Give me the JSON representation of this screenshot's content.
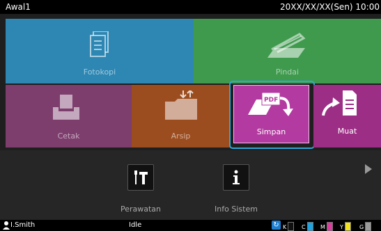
{
  "header": {
    "title": "Awal1",
    "clock": "20XX/XX/XX(Sen) 10:00"
  },
  "tiles": {
    "fotokopi": "Fotokopi",
    "pindai": "Pindai",
    "cetak": "Cetak",
    "arsip": "Arsip",
    "simpan": "Simpan",
    "muat": "Muat",
    "simpan_icon_text": "PDF"
  },
  "tools": {
    "perawatan": "Perawatan",
    "info_sistem": "Info Sistem"
  },
  "status": {
    "user": "I.Smith",
    "state": "Idle",
    "inks": [
      {
        "label": "K",
        "color": "#111111"
      },
      {
        "label": "C",
        "color": "#1fa3e0"
      },
      {
        "label": "M",
        "color": "#d93e9c"
      },
      {
        "label": "Y",
        "color": "#f2e11c"
      },
      {
        "label": "G",
        "color": "#9a9a9a"
      }
    ]
  },
  "colors": {
    "fotokopi": "#2e87b3",
    "pindai": "#3f9a4e",
    "cetak": "#7d3e6d",
    "arsip": "#9c4d1f",
    "simpan": "#b33aa0",
    "muat": "#9c2f85",
    "selection": "#2fa7d8"
  }
}
